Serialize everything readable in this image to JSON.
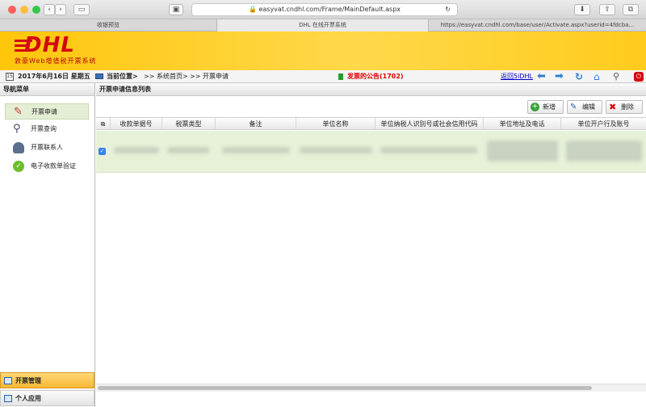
{
  "browser": {
    "url": "easyvat.cndhl.com/Frame/MainDefault.aspx",
    "tabs": [
      "收银预览",
      "DHL 在线开票系统",
      "https://easyvat.cndhl.com/base/user/Activate.aspx?userid=4fdcba..."
    ]
  },
  "banner": {
    "logo": "DHL",
    "slogan": "敦豪Web增值税开票系统"
  },
  "infobar": {
    "date": "2017年6月16日 星期五",
    "location_label": "当前位置>",
    "crumb_home": ">> 系统首页>",
    "crumb_current": ">> 开票申请",
    "announcement": "发票的公告(1702)",
    "return_link": "返回5iDHL"
  },
  "sidebar": {
    "title": "导航菜单",
    "items": [
      {
        "label": "开票申请",
        "icon": "pen-icon"
      },
      {
        "label": "开票查询",
        "icon": "magnifier-icon"
      },
      {
        "label": "开票联系人",
        "icon": "contact-icon"
      },
      {
        "label": "电子收款单验证",
        "icon": "check-icon"
      }
    ],
    "bottom": [
      "开票管理",
      "个人应用"
    ]
  },
  "main": {
    "title": "开票申请信息列表",
    "buttons": {
      "add": "新增",
      "edit": "编辑",
      "delete": "删除"
    },
    "columns": [
      "收款单据号",
      "税票类型",
      "备注",
      "单位名称",
      "单位纳税人识别号或社会信用代码",
      "单位地址及电话",
      "单位开户行及账号"
    ]
  },
  "colors": {
    "brand_yellow": "#ffcc00",
    "brand_red": "#d40511",
    "selected_row": "#e6f1d8"
  }
}
